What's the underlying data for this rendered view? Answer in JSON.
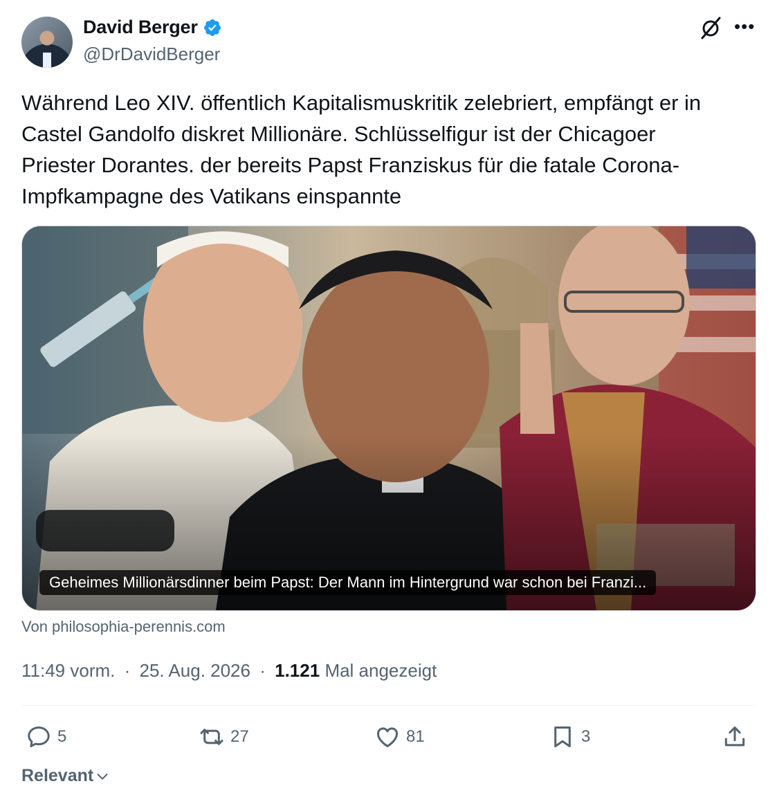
{
  "author": {
    "name": "David Berger",
    "handle": "@DrDavidBerger",
    "verified": true,
    "badge_color": "#1d9bf0"
  },
  "header_icons": [
    "grok-icon",
    "more-icon"
  ],
  "tweet": {
    "text": "Während Leo XIV. öffentlich Kapitalismuskritik zelebriert, empfängt er in\nCastel Gandolfo diskret Millionäre. Schlüsselfigur ist der Chicagoer\nPriester Dorantes. der bereits Papst Franziskus für die fatale Corona-\nImpfkampagne des Vatikans einspannte"
  },
  "link_card": {
    "caption": "Geheimes Millionärsdinner beim Papst: Der Mann im Hintergrund war schon bei Franzi...",
    "source": "Von philosophia-perennis.com"
  },
  "meta": {
    "time": "11:49 vorm.",
    "separator": "·",
    "date": "25. Aug. 2026",
    "views": "1.121",
    "views_label": "Mal angezeigt"
  },
  "actions": {
    "replies": "5",
    "reposts": "27",
    "likes": "81",
    "bookmarks": "3"
  },
  "sort": {
    "label": "Relevant"
  },
  "colors": {
    "text": "#0f1419",
    "secondary": "#536471",
    "accent": "#1d9bf0",
    "border": "#cfd9de"
  }
}
